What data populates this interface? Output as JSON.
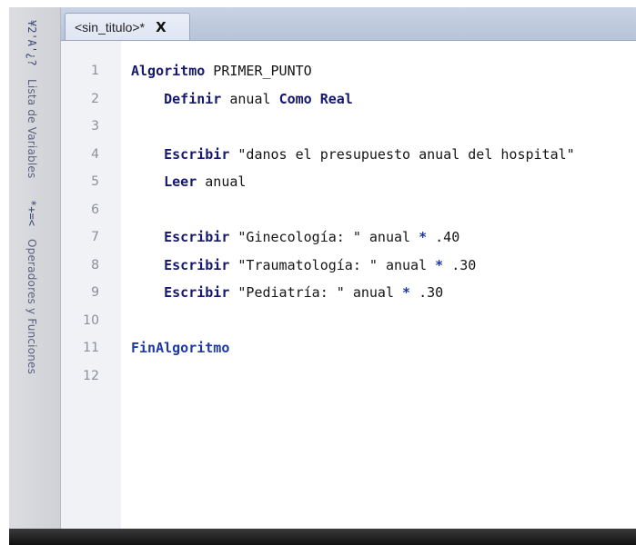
{
  "tab": {
    "title": "<sin_titulo>*",
    "close": "X"
  },
  "side_panel": {
    "symbols_top": "¥2'A'¿?",
    "vars_label": "Lista de Variables",
    "symbols_mid": "*+=<",
    "ops_label": "Operadores y Funciones"
  },
  "lines": [
    {
      "n": "1",
      "parts": [
        {
          "t": "Algoritmo",
          "c": "kw"
        },
        {
          "t": " PRIMER_PUNTO",
          "c": "plain"
        }
      ]
    },
    {
      "n": "2",
      "parts": [
        {
          "t": "    "
        },
        {
          "t": "Definir",
          "c": "kw"
        },
        {
          "t": " anual "
        },
        {
          "t": "Como Real",
          "c": "kw"
        }
      ]
    },
    {
      "n": "3",
      "parts": []
    },
    {
      "n": "4",
      "parts": [
        {
          "t": "    "
        },
        {
          "t": "Escribir",
          "c": "kw"
        },
        {
          "t": " \"danos el presupuesto anual del hospital\""
        }
      ]
    },
    {
      "n": "5",
      "parts": [
        {
          "t": "    "
        },
        {
          "t": "Leer",
          "c": "kw"
        },
        {
          "t": " anual"
        }
      ]
    },
    {
      "n": "6",
      "parts": []
    },
    {
      "n": "7",
      "parts": [
        {
          "t": "    "
        },
        {
          "t": "Escribir",
          "c": "kw"
        },
        {
          "t": " \"Ginecología: \" anual "
        },
        {
          "t": "*",
          "c": "op"
        },
        {
          "t": " .40"
        }
      ]
    },
    {
      "n": "8",
      "parts": [
        {
          "t": "    "
        },
        {
          "t": "Escribir",
          "c": "kw"
        },
        {
          "t": " \"Traumatología: \" anual "
        },
        {
          "t": "*",
          "c": "op"
        },
        {
          "t": " .30"
        }
      ]
    },
    {
      "n": "9",
      "parts": [
        {
          "t": "    "
        },
        {
          "t": "Escribir",
          "c": "kw"
        },
        {
          "t": " \"Pediatría: \" anual "
        },
        {
          "t": "*",
          "c": "op"
        },
        {
          "t": " .30"
        }
      ]
    },
    {
      "n": "10",
      "parts": []
    },
    {
      "n": "11",
      "parts": [
        {
          "t": "FinAlgoritmo",
          "c": "kw-blue"
        }
      ]
    },
    {
      "n": "12",
      "parts": []
    }
  ]
}
